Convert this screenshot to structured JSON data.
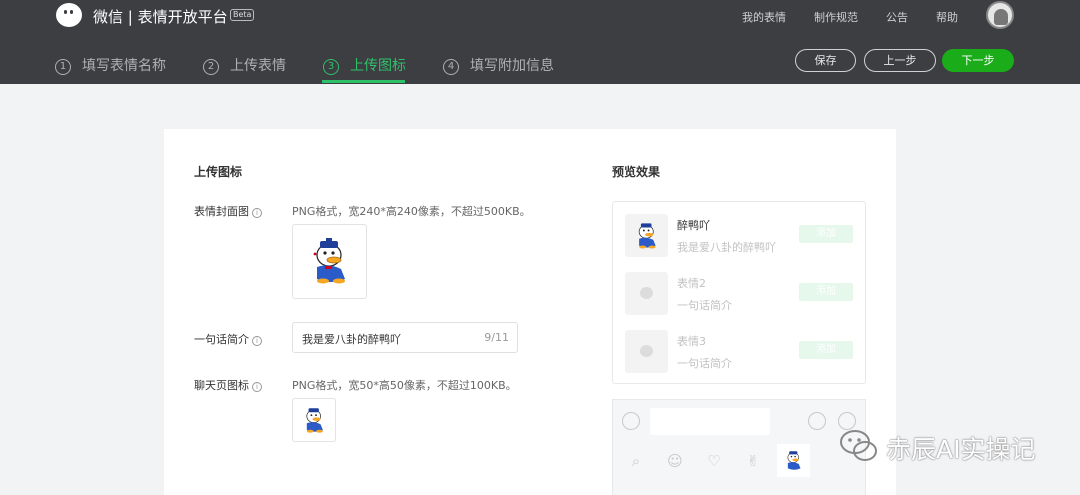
{
  "header": {
    "brand": "微信 | 表情开放平台",
    "beta": "Beta",
    "nav": [
      "我的表情",
      "制作规范",
      "公告",
      "帮助"
    ],
    "steps": [
      {
        "num": "1",
        "label": "填写表情名称"
      },
      {
        "num": "2",
        "label": "上传表情"
      },
      {
        "num": "3",
        "label": "上传图标"
      },
      {
        "num": "4",
        "label": "填写附加信息"
      }
    ],
    "active_step": 3,
    "buttons": {
      "save": "保存",
      "prev": "上一步",
      "next": "下一步"
    },
    "colors": {
      "accent": "#2fc16a",
      "header_bg": "#3c3e42",
      "primary_button": "#1aad19"
    }
  },
  "upload": {
    "title": "上传图标",
    "cover": {
      "label": "表情封面图",
      "hint": "PNG格式，宽240*高240像素，不超过500KB。",
      "icon": "donald-duck-sticker"
    },
    "intro": {
      "label": "一句话简介",
      "value": "我是爱八卦的醉鸭吖",
      "count": "9/11"
    },
    "chat_icon": {
      "label": "聊天页图标",
      "hint": "PNG格式，宽50*高50像素，不超过100KB。",
      "icon": "donald-duck-sticker"
    },
    "info_icon": "i"
  },
  "preview": {
    "title": "预览效果",
    "items": [
      {
        "name": "醉鸭吖",
        "desc": "我是爱八卦的醉鸭吖",
        "add": "添加"
      },
      {
        "name": "表情2",
        "desc": "一句话简介",
        "add": "添加"
      },
      {
        "name": "表情3",
        "desc": "一句话简介",
        "add": "添加"
      }
    ]
  },
  "watermark": {
    "text": "赤辰AI实操记"
  }
}
